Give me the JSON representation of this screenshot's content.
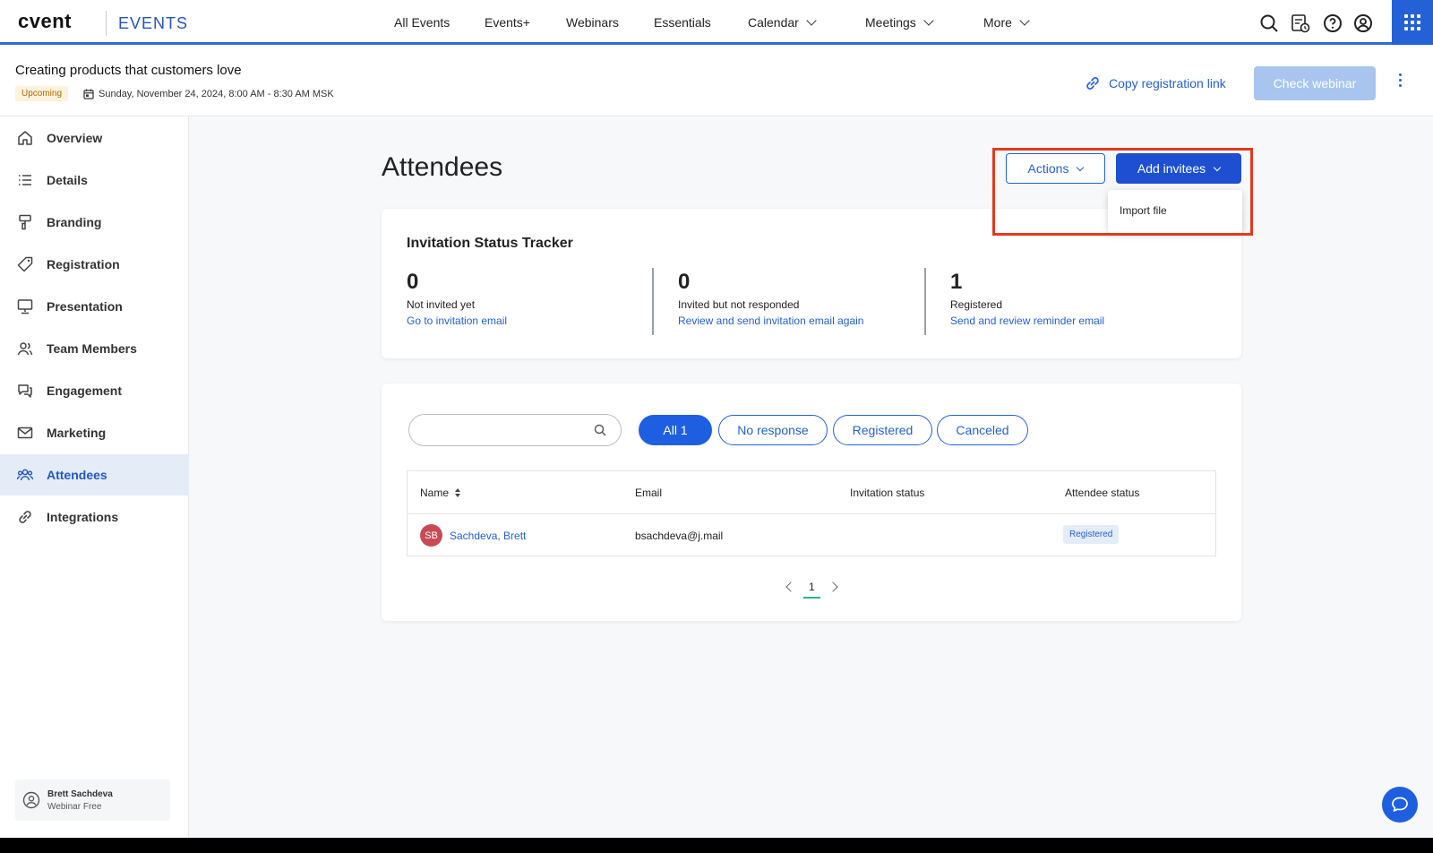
{
  "topbar": {
    "logo": "cvent",
    "product": "EVENTS",
    "nav": [
      "All Events",
      "Events+",
      "Webinars",
      "Essentials",
      "Calendar",
      "Meetings",
      "More"
    ]
  },
  "event": {
    "title": "Creating products that customers love",
    "status": "Upcoming",
    "date": "Sunday, November 24, 2024, 8:00 AM - 8:30 AM MSK",
    "copy_link": "Copy registration link",
    "check_webinar": "Check webinar"
  },
  "sidebar": {
    "items": [
      {
        "label": "Overview",
        "icon": "home-icon"
      },
      {
        "label": "Details",
        "icon": "list-icon"
      },
      {
        "label": "Branding",
        "icon": "paint-roller-icon"
      },
      {
        "label": "Registration",
        "icon": "tag-icon"
      },
      {
        "label": "Presentation",
        "icon": "presentation-icon"
      },
      {
        "label": "Team Members",
        "icon": "people-icon"
      },
      {
        "label": "Engagement",
        "icon": "chat-icon"
      },
      {
        "label": "Marketing",
        "icon": "mail-icon"
      },
      {
        "label": "Attendees",
        "icon": "attendees-icon",
        "active": true
      },
      {
        "label": "Integrations",
        "icon": "link-icon"
      }
    ],
    "user": {
      "name": "Brett Sachdeva",
      "plan": "Webinar Free"
    }
  },
  "main": {
    "title": "Attendees",
    "actions_label": "Actions",
    "add_label": "Add invitees",
    "dropdown": {
      "items": [
        "Import file"
      ]
    },
    "tracker": {
      "title": "Invitation Status Tracker",
      "stats": [
        {
          "value": "0",
          "label": "Not invited yet",
          "link": "Go to invitation email"
        },
        {
          "value": "0",
          "label": "Invited but not responded",
          "link": "Review and send invitation email again"
        },
        {
          "value": "1",
          "label": "Registered",
          "link": "Send and review reminder email"
        }
      ]
    },
    "search": {
      "placeholder": ""
    },
    "filters": [
      "All 1",
      "No response",
      "Registered",
      "Canceled"
    ],
    "table": {
      "columns": [
        "Name",
        "Email",
        "Invitation status",
        "Attendee status"
      ],
      "rows": [
        {
          "initials": "SB",
          "name": "Sachdeva, Brett",
          "email": "bsachdeva@j.mail",
          "invitation_status": "",
          "attendee_status": "Registered"
        }
      ]
    },
    "pagination": {
      "current": "1"
    }
  },
  "colors": {
    "accent": "#2461d6",
    "highlight": "#e33a1f",
    "avatar": "#c94a55"
  }
}
